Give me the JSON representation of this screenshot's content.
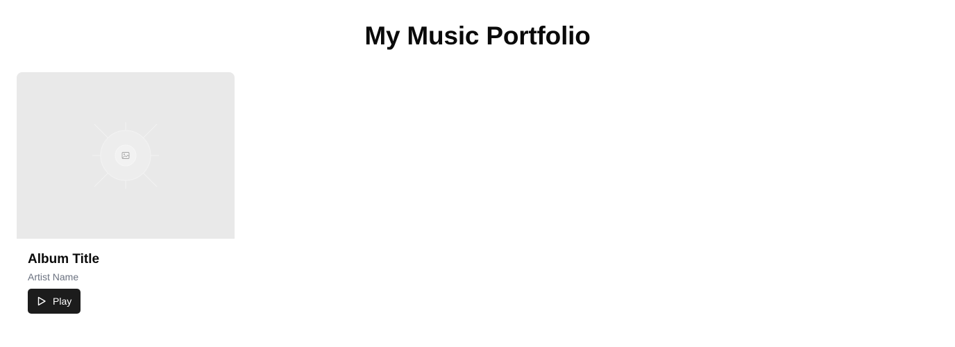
{
  "page": {
    "title": "My Music Portfolio"
  },
  "albums": [
    {
      "title": "Album Title",
      "artist": "Artist Name",
      "cover_icon": "image-placeholder-icon",
      "play_label": "Play",
      "play_icon": "play-icon"
    }
  ],
  "colors": {
    "button_bg": "#1c1c1c",
    "cover_bg": "#e9e9e9",
    "artist_text": "#6b7280"
  }
}
